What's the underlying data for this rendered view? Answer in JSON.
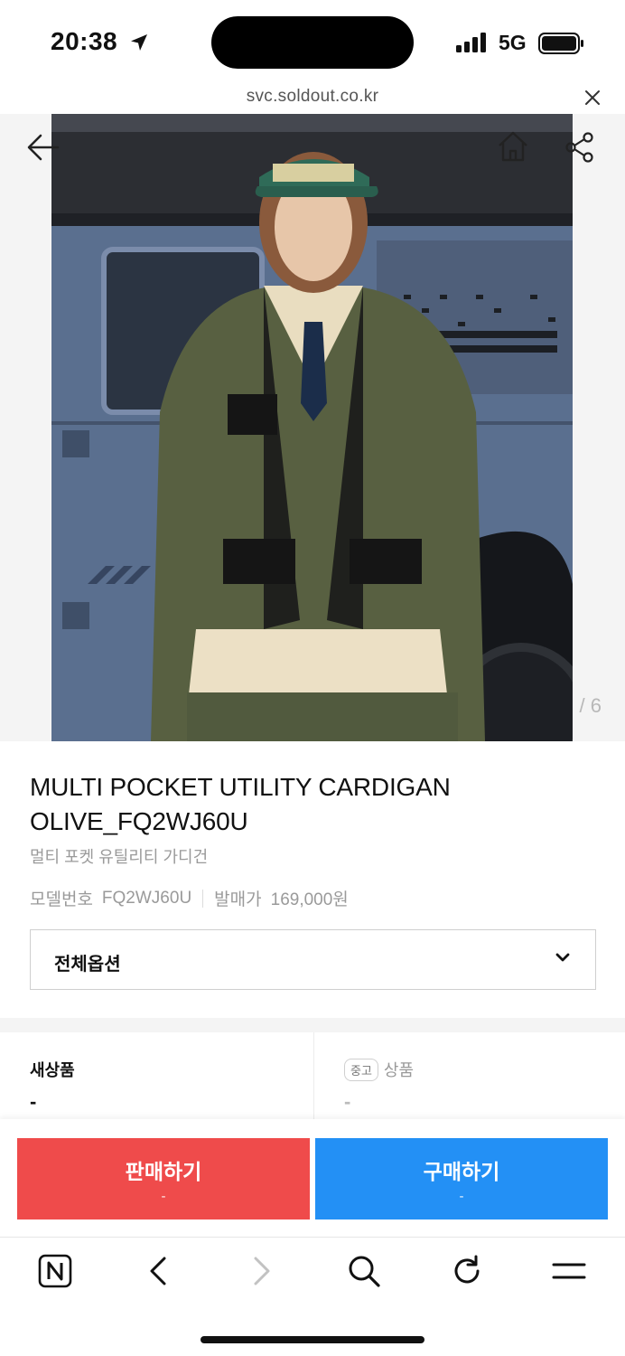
{
  "status_bar": {
    "time": "20:38",
    "network": "5G"
  },
  "url_bar": {
    "url": "svc.soldout.co.kr"
  },
  "hero": {
    "counter": "/ 6"
  },
  "product": {
    "title": "MULTI POCKET UTILITY CARDIGAN OLIVE_FQ2WJ60U",
    "subtitle": "멀티 포켓 유틸리티 가디건",
    "model_label": "모델번호",
    "model_number": "FQ2WJ60U",
    "release_label": "발매가",
    "release_price": "169,000원"
  },
  "options": {
    "label": "전체옵션"
  },
  "prices": {
    "new": {
      "title": "새상품",
      "value": "-"
    },
    "used": {
      "badge": "중고",
      "title": "상품",
      "value": "-"
    }
  },
  "cta": {
    "sell": {
      "label": "판매하기",
      "sub": "-"
    },
    "buy": {
      "label": "구매하기",
      "sub": "-"
    }
  },
  "colors": {
    "sell": "#ef4b4b",
    "buy": "#2390f5"
  },
  "icons": [
    "location-arrow-icon",
    "signal-icon",
    "battery-icon",
    "close-icon",
    "back-arrow-icon",
    "home-icon",
    "share-icon",
    "chevron-down-icon",
    "naver-icon",
    "back-icon",
    "forward-icon",
    "search-icon",
    "refresh-icon",
    "menu-icon"
  ]
}
